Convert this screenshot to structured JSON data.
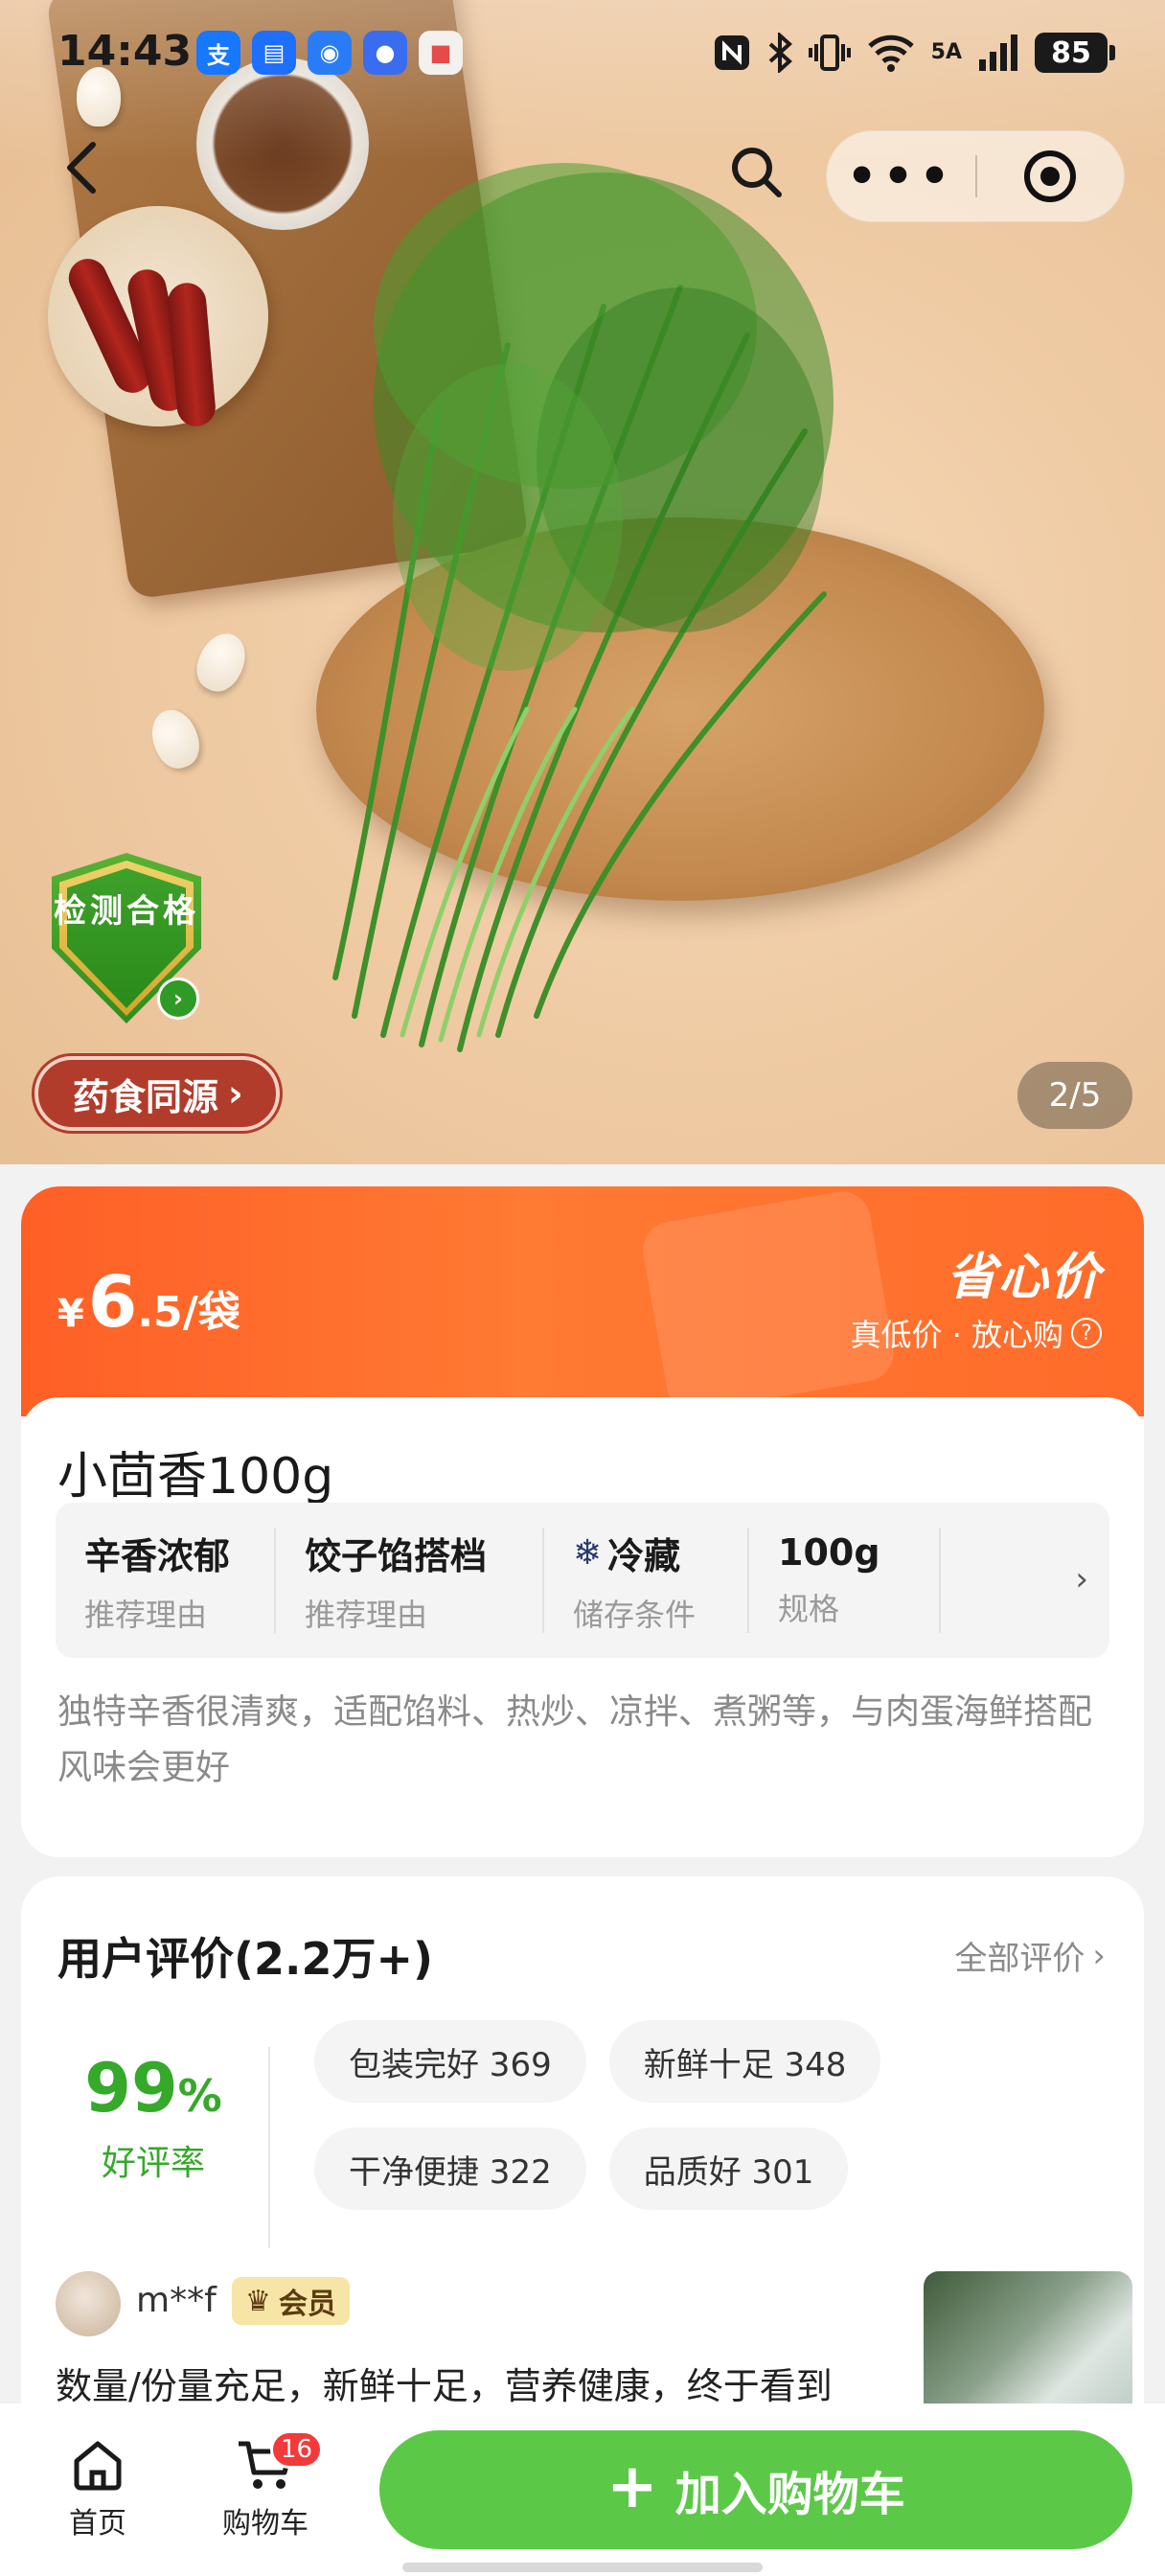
{
  "status_bar": {
    "time": "14:43",
    "network": "5A",
    "battery": "85"
  },
  "hero": {
    "page_indicator": "2/5",
    "test_badge": "检测合格",
    "origin_tag": "药食同源"
  },
  "price": {
    "currency": "¥",
    "integer": "6",
    "decimal": ".5",
    "unit": "/袋",
    "badge_title": "省心价",
    "badge_sub": "真低价 · 放心购"
  },
  "product": {
    "title": "小茴香100g",
    "attributes": [
      {
        "value": "辛香浓郁",
        "key": "推荐理由",
        "icon": ""
      },
      {
        "value": "饺子馅搭档",
        "key": "推荐理由",
        "icon": ""
      },
      {
        "value": "冷藏",
        "key": "储存条件",
        "icon": "snowflake-icon"
      },
      {
        "value": "100g",
        "key": "规格",
        "icon": ""
      }
    ],
    "description": "独特辛香很清爽，适配馅料、热炒、凉拌、煮粥等，与肉蛋海鲜搭配风味会更好"
  },
  "reviews": {
    "title": "用户评价(2.2万+)",
    "all_label": "全部评价",
    "rate_value": "99",
    "rate_unit": "%",
    "rate_label": "好评率",
    "tags": [
      {
        "label": "包装完好 369"
      },
      {
        "label": "新鲜十足 348"
      },
      {
        "label": "干净便捷 322"
      },
      {
        "label": "品质好 301"
      }
    ],
    "item": {
      "user": "m**f",
      "badge": "会员",
      "text": "数量/份量充足，新鲜十足，营养健康，终于看到"
    }
  },
  "bottom_bar": {
    "home_label": "首页",
    "cart_label": "购物车",
    "cart_count": "16",
    "add_to_cart": "加入购物车"
  },
  "colors": {
    "accent_green": "#5cc848",
    "price_orange": "#ff6b2a",
    "rate_green": "#35a92a",
    "badge_red": "#f23a3a"
  }
}
